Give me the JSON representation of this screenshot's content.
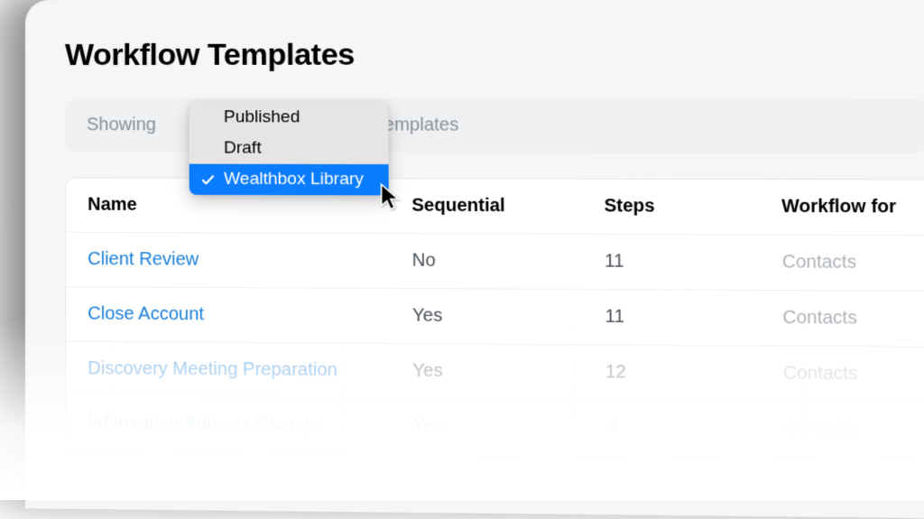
{
  "page_title": "Workflow Templates",
  "filter": {
    "prefix": "Showing",
    "suffix": "templates",
    "options": [
      {
        "label": "Published",
        "selected": false
      },
      {
        "label": "Draft",
        "selected": false
      },
      {
        "label": "Wealthbox Library",
        "selected": true
      }
    ]
  },
  "table": {
    "columns": {
      "name": "Name",
      "sequential": "Sequential",
      "steps": "Steps",
      "workflow_for": "Workflow for"
    },
    "rows": [
      {
        "name": "Client Review",
        "sequential": "No",
        "steps": "11",
        "workflow_for": "Contacts"
      },
      {
        "name": "Close Account",
        "sequential": "Yes",
        "steps": "11",
        "workflow_for": "Contacts"
      },
      {
        "name": "Discovery Meeting Preparation",
        "sequential": "Yes",
        "steps": "12",
        "workflow_for": "Contacts"
      },
      {
        "name": "Information/Address Change",
        "sequential": "Yes",
        "steps": "9",
        "workflow_for": "Contacts"
      }
    ]
  }
}
